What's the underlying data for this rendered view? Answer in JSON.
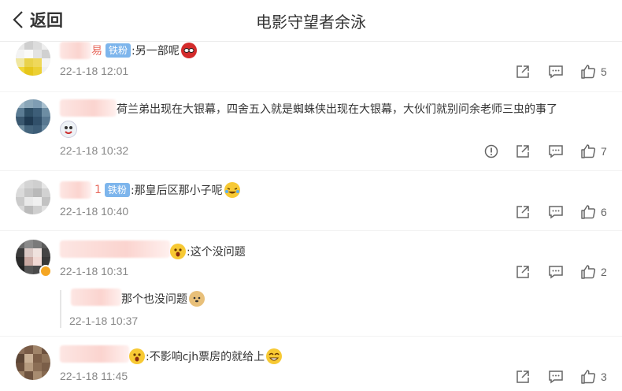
{
  "header": {
    "back_label": "返回",
    "title": "电影守望者余泳"
  },
  "comments": [
    {
      "name_suffix": "易",
      "badge": "铁粉",
      "text": ":另一部呢",
      "emoji": "spider-man-emoji",
      "time": "22-1-18 12:01",
      "likes": "5"
    },
    {
      "text": "荷兰弟出现在大银幕，四舍五入就是蜘蛛侠出现在大银幕，大伙们就别问余老师三虫的事了",
      "emoji": "mask-emoji",
      "time": "22-1-18 10:32",
      "likes": "7"
    },
    {
      "name_suffix": "1",
      "badge": "铁粉",
      "text": ":那皇后区那小子呢",
      "emoji": "crying-laugh-emoji",
      "time": "22-1-18 10:40",
      "likes": "6"
    },
    {
      "text": ":这个没问题",
      "emoji": "shocked-emoji",
      "time": "22-1-18 10:31",
      "likes": "2",
      "reply": {
        "text": "那个也没问题",
        "emoji": "doge-emoji",
        "time": "22-1-18 10:37"
      }
    },
    {
      "text": ":不影响cjh票房的就给上",
      "emoji": "grin-emoji",
      "time": "22-1-18 11:45",
      "likes": "3"
    }
  ],
  "colors": {
    "badge": "#7db5ec",
    "meta": "#888888",
    "icon": "#666666"
  }
}
